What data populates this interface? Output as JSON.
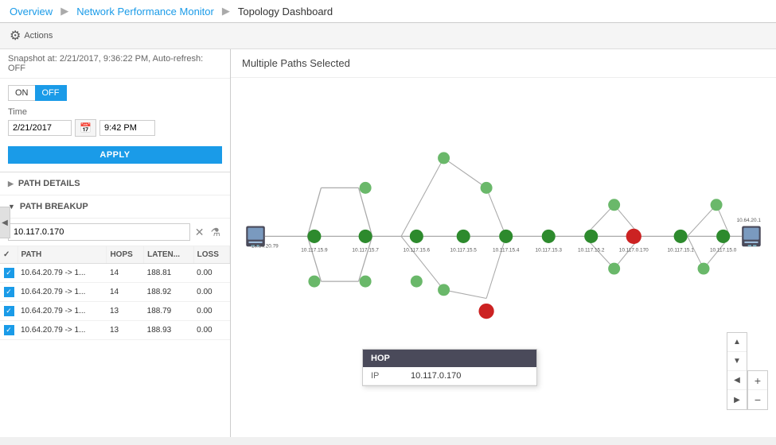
{
  "breadcrumb": {
    "overview": "Overview",
    "app": "Network Performance Monitor",
    "page": "Topology Dashboard"
  },
  "actions": {
    "label": "Actions",
    "icon": "⚙"
  },
  "snapshot": {
    "text": "Snapshot at: 2/21/2017, 9:36:22 PM, Auto-refresh: OFF"
  },
  "toggle": {
    "on_label": "ON",
    "off_label": "OFF"
  },
  "time_section": {
    "label": "Time",
    "date_value": "2/21/2017",
    "time_value": "9:42 PM",
    "apply_label": "APPLY"
  },
  "path_details": {
    "label": "PATH DETAILS"
  },
  "path_breakup": {
    "label": "PATH BREAKUP",
    "search_placeholder": "10.117.0.170",
    "search_value": "10.117.0.170",
    "columns": [
      "",
      "PATH",
      "HOPS",
      "LATEN...",
      "LOSS"
    ],
    "rows": [
      {
        "path": "10.64.20.79 -> 1...",
        "hops": "14",
        "latency": "188.81",
        "loss": "0.00"
      },
      {
        "path": "10.64.20.79 -> 1...",
        "hops": "14",
        "latency": "188.92",
        "loss": "0.00"
      },
      {
        "path": "10.64.20.79 -> 1...",
        "hops": "13",
        "latency": "188.79",
        "loss": "0.00"
      },
      {
        "path": "10.64.20.79 -> 1...",
        "hops": "13",
        "latency": "188.93",
        "loss": "0.00"
      }
    ]
  },
  "topology": {
    "title": "Multiple Paths Selected"
  },
  "hop_tooltip": {
    "header": "HOP",
    "key": "IP",
    "value": "10.117.0.170"
  },
  "zoom": {
    "plus": "+",
    "minus": "−",
    "up": "▲",
    "down": "▼",
    "left": "◀",
    "right": "▶"
  }
}
